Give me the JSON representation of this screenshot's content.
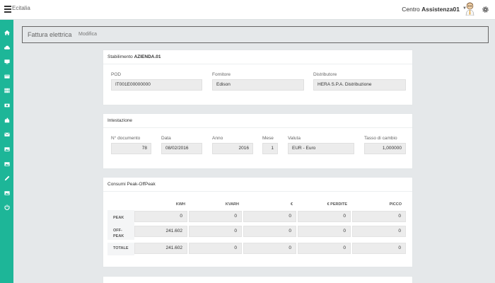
{
  "topbar": {
    "brand": "Ecitalia",
    "user_prefix": "Centro ",
    "user_name": "Assistenza01"
  },
  "sidebar": {
    "icons": [
      "home-icon",
      "cloud-icon",
      "monitor-icon",
      "card-icon",
      "grid-icon",
      "money-icon",
      "tools-icon",
      "mail-icon",
      "image-icon",
      "image-icon",
      "pencil-icon",
      "image-icon",
      "power-icon"
    ]
  },
  "title": {
    "main": "Fattura elettrica",
    "sub": "Modifica"
  },
  "stabilimento": {
    "heading_prefix": "Stabilimento ",
    "heading_name": "AZIENDA.01",
    "pod_label": "POD",
    "pod_value": "IT001E00000000",
    "fornitore_label": "Fornitore",
    "fornitore_value": "Edison",
    "distributore_label": "Distributore",
    "distributore_value": "HERA S.P.A. Distribuzione"
  },
  "intestazione": {
    "heading": "Intestazione",
    "documento_label": "N° documento",
    "documento_value": "78",
    "data_label": "Data",
    "data_value": "08/02/2016",
    "anno_label": "Anno",
    "anno_value": "2016",
    "mese_label": "Mese",
    "mese_value": "1",
    "valuta_label": "Valuta",
    "valuta_value": "EUR - Euro",
    "tasso_label": "Tasso di cambio",
    "tasso_value": "1,000000"
  },
  "consumi": {
    "heading": "Consumi Peak-OffPeak",
    "columns": [
      "KWH",
      "KVARH",
      "€",
      "€ PERDITE",
      "PICCO"
    ],
    "rows": [
      {
        "label": "PEAK",
        "values": [
          "0",
          "0",
          "0",
          "0",
          "0"
        ]
      },
      {
        "label": "OFF-PEAK",
        "values": [
          "241.602",
          "0",
          "0",
          "0",
          "0"
        ]
      },
      {
        "label": "TOTALE",
        "values": [
          "241.602",
          "0",
          "0",
          "0",
          "0"
        ]
      }
    ]
  },
  "colors": {
    "sidebar": "#1db698"
  }
}
